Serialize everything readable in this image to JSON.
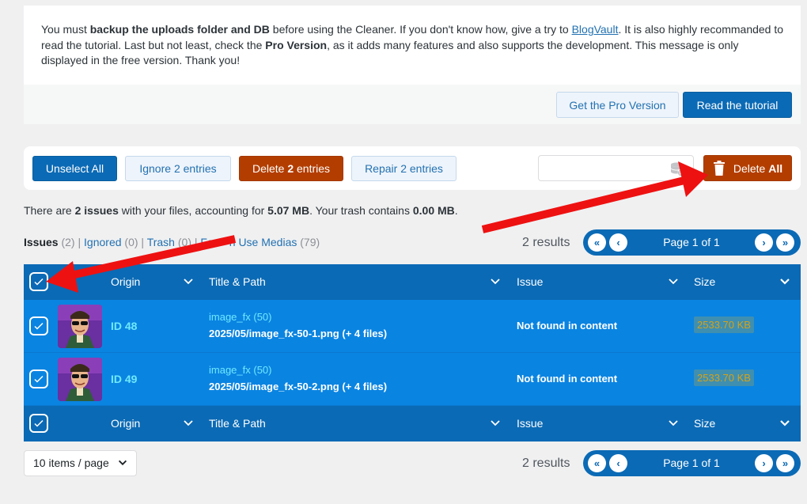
{
  "notice": {
    "text_1": "You must ",
    "text_bold_1": "backup the uploads folder and DB",
    "text_2": " before using the Cleaner. If you don't know how, give a try to ",
    "link_blogvault": "BlogVault",
    "text_3": ". It is also highly recommanded to read the tutorial. Last but not least, check the ",
    "text_bold_2": "Pro Version",
    "text_4": ", as it adds many features and also supports the development. This message is only displayed in the free version. Thank you!",
    "get_pro_label": "Get the Pro Version",
    "read_tutorial_label": "Read the tutorial"
  },
  "toolbar": {
    "unselect_all": "Unselect All",
    "ignore_pre": "Ignore ",
    "ignore_count": "2",
    "ignore_post": " entries",
    "delete_pre": "Delete ",
    "delete_count": "2",
    "delete_post": " entries",
    "repair_pre": "Repair ",
    "repair_count": "2",
    "repair_post": " entries",
    "search_value": "",
    "delete_all_pre": "Delete ",
    "delete_all_bold": "All"
  },
  "summary": {
    "t1": "There are ",
    "issues_count": "2 issues",
    "t2": " with your files, accounting for ",
    "size": "5.07 MB",
    "t3": ". Your trash contains ",
    "trash_size": "0.00 MB",
    "t4": "."
  },
  "filters": {
    "issues_label": "Issues",
    "issues_count": "(2)",
    "sep1": "|",
    "ignored_label": "Ignored",
    "ignored_count": "(0)",
    "sep2": "|",
    "trash_label": "Trash",
    "trash_count": "(0)",
    "sep3": "|",
    "in_use_visible_start": "Fo",
    "in_use_visible_end": "n Use Medias",
    "in_use_count": "(79)"
  },
  "pagination": {
    "results": "2 results",
    "page_label": "Page 1 of 1"
  },
  "table": {
    "columns": [
      "Origin",
      "Title & Path",
      "Issue",
      "Size"
    ],
    "rows": [
      {
        "id": "ID 48",
        "title": "image_fx (50)",
        "path": "2025/05/image_fx-50-1.png (+ 4 files)",
        "issue": "Not found in content",
        "size": "2533.70 KB"
      },
      {
        "id": "ID 49",
        "title": "image_fx (50)",
        "path": "2025/05/image_fx-50-2.png (+ 4 files)",
        "issue": "Not found in content",
        "size": "2533.70 KB"
      }
    ]
  },
  "per_page": "10 items / page",
  "colors": {
    "primary": "#0b6ab5",
    "row": "#0a84e1",
    "danger": "#b33d00",
    "arrow": "#ee1111"
  }
}
